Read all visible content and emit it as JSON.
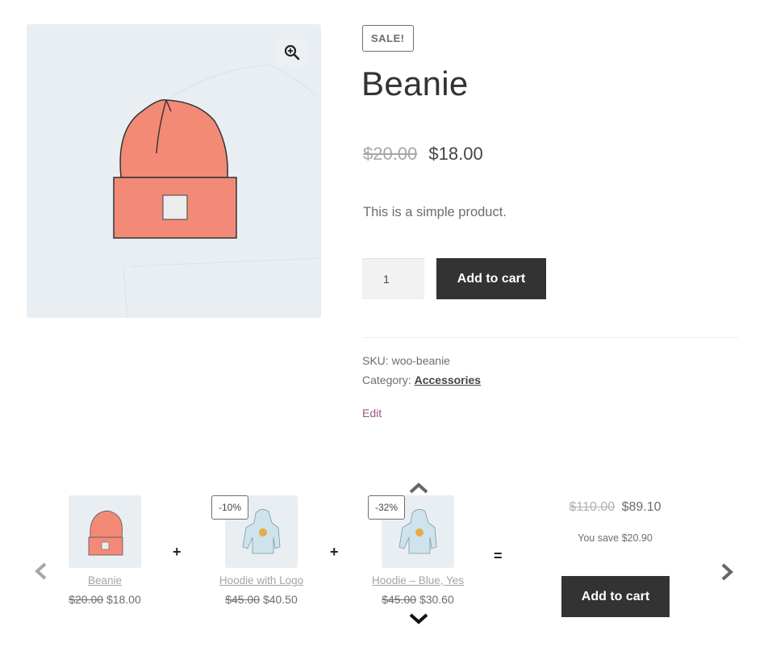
{
  "product": {
    "sale_badge": "SALE!",
    "title": "Beanie",
    "regular_price": "$20.00",
    "sale_price": "$18.00",
    "short_description": "This is a simple product.",
    "quantity": "1",
    "add_to_cart_label": "Add to cart",
    "sku_label": "SKU:",
    "sku_value": "woo-beanie",
    "category_label": "Category:",
    "category_value": "Accessories",
    "edit_label": "Edit",
    "gallery_icon": "zoom-in-icon"
  },
  "bundle": {
    "items": [
      {
        "name": "Beanie",
        "regular_price": "$20.00",
        "sale_price": "$18.00",
        "discount": ""
      },
      {
        "name": "Hoodie with Logo",
        "regular_price": "$45.00",
        "sale_price": "$40.50",
        "discount": "-10%"
      },
      {
        "name": "Hoodie – Blue, Yes",
        "regular_price": "$45.00",
        "sale_price": "$30.60",
        "discount": "-32%"
      }
    ],
    "plus_sign": "+",
    "equals_sign": "=",
    "total_regular": "$110.00",
    "total_sale": "$89.10",
    "you_save": "You save $20.90",
    "add_to_cart_label": "Add to cart",
    "icons": [
      "chevron-left-icon",
      "chevron-right-icon",
      "chevron-up-icon",
      "chevron-down-icon"
    ]
  }
}
